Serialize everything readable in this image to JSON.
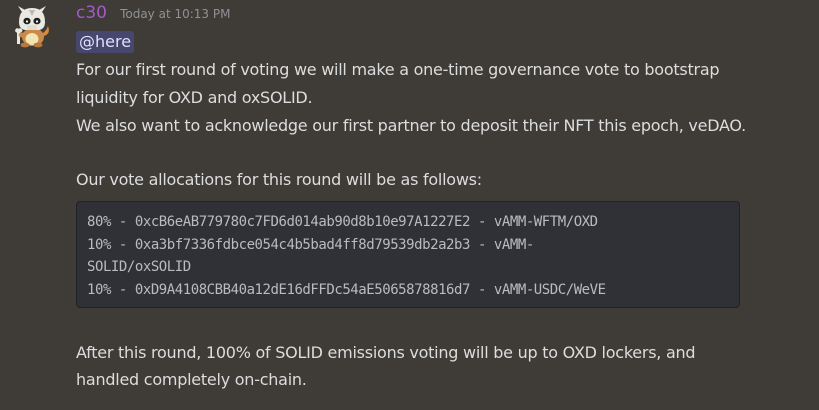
{
  "message": {
    "author": "c30",
    "timestamp": "Today at 10:13 PM",
    "author_color": "#a45bc9",
    "mention": "@here",
    "lines": [
      "For our first round of voting we will make a one-time governance vote to bootstrap",
      "liquidity for OXD and oxSOLID.",
      "We also want to acknowledge our first partner to deposit their NFT this epoch, veDAO.",
      "Our vote allocations for this round will be as follows:"
    ],
    "code_lines": [
      "80% - 0xcB6eAB779780c7FD6d014ab90d8b10e97A1227E2 - vAMM-WFTM/OXD",
      "10% - 0xa3bf7336fdbce054c4b5bad4ff8d79539db2a2b3 - vAMM-",
      "SOLID/oxSOLID",
      "10% - 0xD9A4108CBB40a12dE16dFFDc54aE5065878816d7 - vAMM-USDC/WeVE"
    ],
    "closing_lines": [
      "After this round, 100% of SOLID emissions voting will be up to OXD lockers, and",
      "handled completely on-chain."
    ]
  },
  "avatar": {
    "icon": "cubone-avatar-icon"
  }
}
